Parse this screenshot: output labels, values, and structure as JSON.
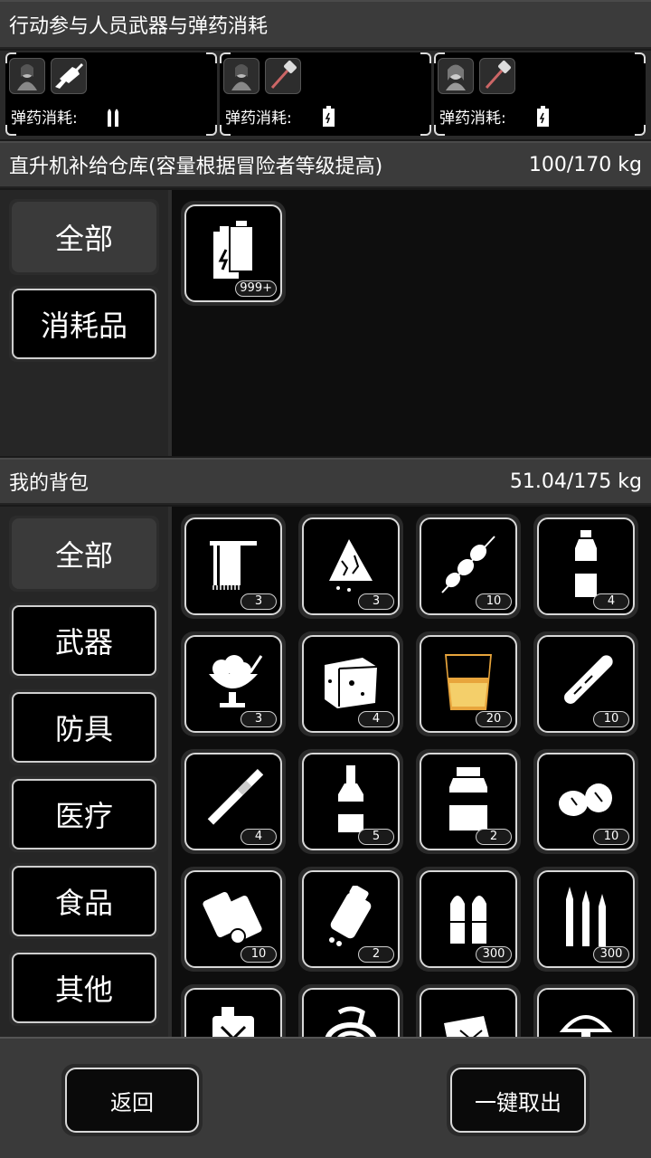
{
  "header": {
    "title": "行动参与人员武器与弹药消耗"
  },
  "party": [
    {
      "ammo_label": "弹药消耗:",
      "weapon_icon": "rifle-icon",
      "avatar_icon": "character-avatar-icon",
      "ammo_icon": "bullets-icon"
    },
    {
      "ammo_label": "弹药消耗:",
      "weapon_icon": "hammer-icon",
      "avatar_icon": "character-avatar-icon",
      "ammo_icon": "battery-icon"
    },
    {
      "ammo_label": "弹药消耗:",
      "weapon_icon": "hammer-icon",
      "avatar_icon": "character-avatar-icon",
      "ammo_icon": "battery-icon"
    }
  ],
  "warehouse": {
    "title": "直升机补给仓库(容量根据冒险者等级提高)",
    "capacity": "100/170 kg",
    "categories": [
      {
        "label": "全部",
        "active": true
      },
      {
        "label": "消耗品",
        "active": false
      }
    ],
    "items": [
      {
        "icon": "battery-icon",
        "count": "999+"
      }
    ]
  },
  "backpack": {
    "title": "我的背包",
    "capacity": "51.04/175 kg",
    "categories": [
      {
        "label": "全部",
        "active": true
      },
      {
        "label": "武器",
        "active": false
      },
      {
        "label": "防具",
        "active": false
      },
      {
        "label": "医疗",
        "active": false
      },
      {
        "label": "食品",
        "active": false
      },
      {
        "label": "其他",
        "active": false
      }
    ],
    "items": [
      {
        "icon": "towel-icon",
        "count": "3"
      },
      {
        "icon": "cloth-icon",
        "count": "3"
      },
      {
        "icon": "skewer-icon",
        "count": "10"
      },
      {
        "icon": "water-bottle-icon",
        "count": "4"
      },
      {
        "icon": "ice-cream-icon",
        "count": "3"
      },
      {
        "icon": "cheese-block-icon",
        "count": "4"
      },
      {
        "icon": "juice-glass-icon",
        "count": "20"
      },
      {
        "icon": "cigar-icon",
        "count": "10"
      },
      {
        "icon": "cigarette-icon",
        "count": "4"
      },
      {
        "icon": "liquor-bottle-icon",
        "count": "5"
      },
      {
        "icon": "jar-icon",
        "count": "2"
      },
      {
        "icon": "eggs-icon",
        "count": "10"
      },
      {
        "icon": "bandage-roll-icon",
        "count": "10"
      },
      {
        "icon": "pill-bottle-icon",
        "count": "2"
      },
      {
        "icon": "pistol-ammo-icon",
        "count": "300"
      },
      {
        "icon": "rifle-ammo-icon",
        "count": "300"
      },
      {
        "icon": "fuel-can-icon",
        "count": ""
      },
      {
        "icon": "rope-icon",
        "count": ""
      },
      {
        "icon": "toolbox-icon",
        "count": ""
      },
      {
        "icon": "mushroom-icon",
        "count": ""
      }
    ]
  },
  "footer": {
    "back_label": "返回",
    "take_all_label": "一键取出"
  }
}
